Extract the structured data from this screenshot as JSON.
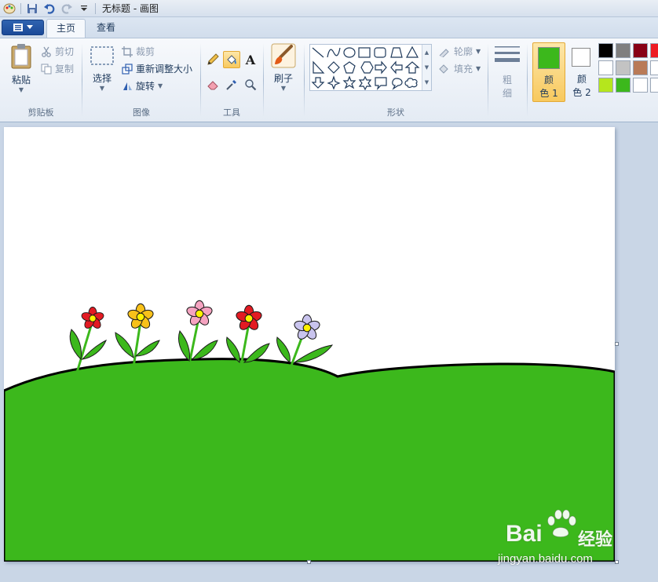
{
  "window": {
    "title": "无标题 - 画图"
  },
  "tabs": [
    {
      "label": "主页"
    },
    {
      "label": "查看"
    }
  ],
  "ribbon": {
    "clipboard": {
      "group_label": "剪贴板",
      "paste": "粘贴",
      "cut": "剪切",
      "copy": "复制"
    },
    "image": {
      "group_label": "图像",
      "select": "选择",
      "crop": "裁剪",
      "resize": "重新调整大小",
      "rotate": "旋转"
    },
    "tools": {
      "group_label": "工具",
      "text_tool_glyph": "A"
    },
    "brushes": {
      "label": "刷子"
    },
    "shapes": {
      "group_label": "形状",
      "outline": "轮廓",
      "fill": "填充"
    },
    "size": {
      "label_top": "粗",
      "label_bottom": "细"
    },
    "colors": {
      "color1_top": "颜",
      "color1_bottom": "色 1",
      "color2_top": "颜",
      "color2_bottom": "色 2",
      "color1_value": "#3cb81c",
      "color2_value": "#ffffff",
      "palette": [
        "#000000",
        "#7f7f7f",
        "#880015",
        "#ed1c24",
        "#ffffff",
        "#c3c3c3",
        "#b97a57",
        "#ffffff",
        "#b5e61d",
        "#3cb81c",
        "#ffffff",
        "#ffffff"
      ]
    }
  },
  "canvas": {
    "grass_color": "#3cb81c",
    "flower_colors": [
      "#e31b23",
      "#f8c11a",
      "#f5a3c0",
      "#e31b23",
      "#c9c4ee"
    ]
  },
  "watermark": {
    "brand": "Bai",
    "brand_cn": "经验",
    "url": "jingyan.baidu.com"
  }
}
